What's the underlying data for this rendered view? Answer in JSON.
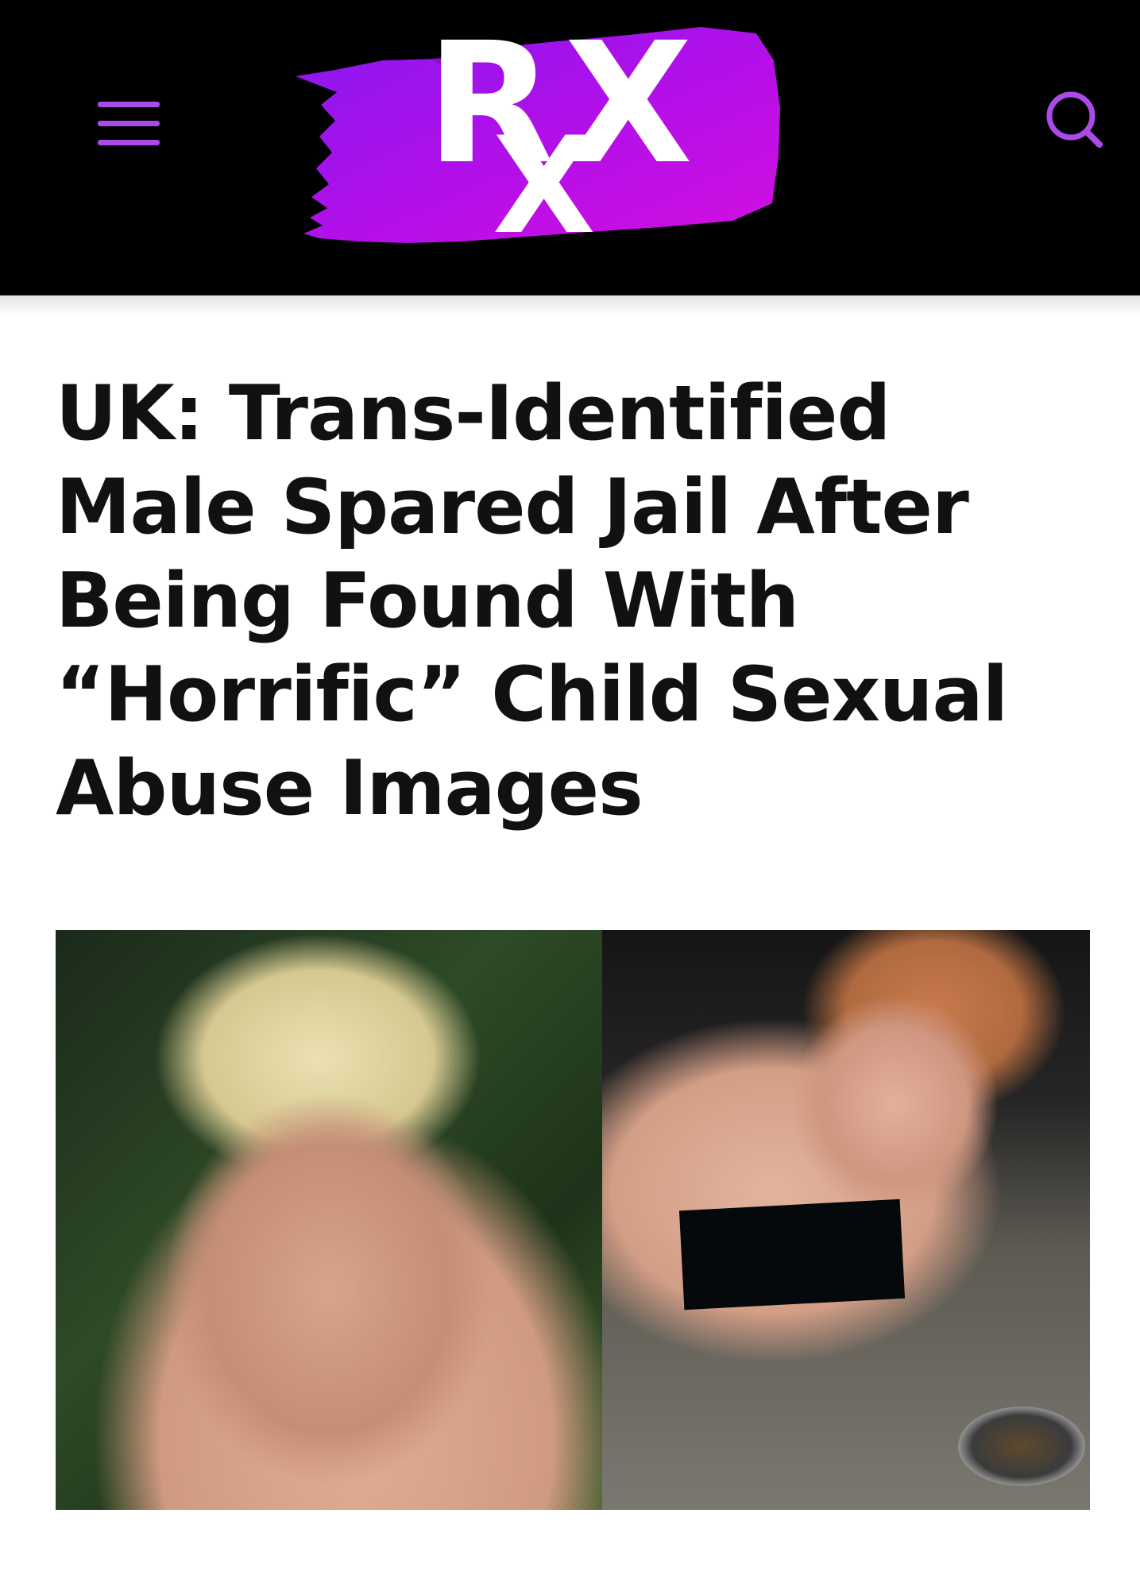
{
  "header": {
    "logo": {
      "text_main_left": "R",
      "text_main_right": "X",
      "text_sub": "X",
      "accent_color": "#b20fe8"
    },
    "menu_icon": "hamburger-menu-icon",
    "search_icon": "search-icon",
    "icon_color": "#a94be8"
  },
  "article": {
    "headline": "UK: Trans-Identified Male Spared Jail After Being Found With “Horrific” Child Sexual Abuse Images"
  }
}
